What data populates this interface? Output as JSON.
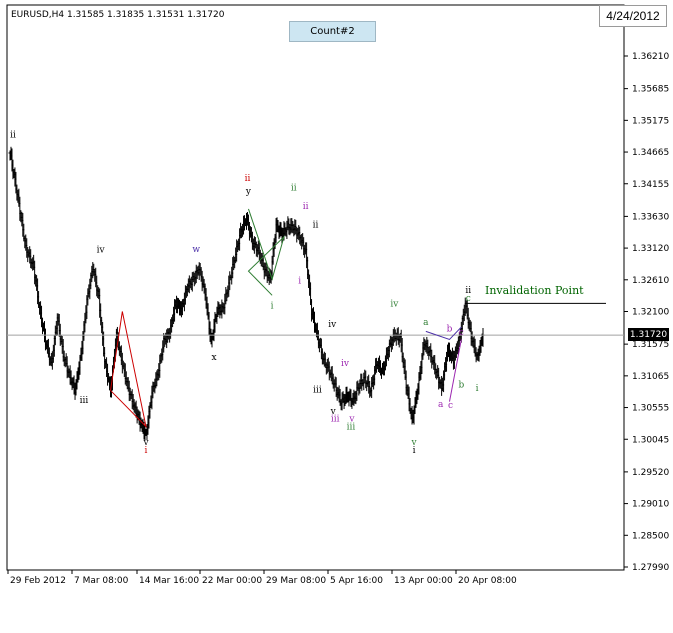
{
  "header": {
    "symbol_info": "EURUSD,H4  1.31585 1.31835 1.31531 1.31720",
    "count_label": "Count#2",
    "date_stamp": "4/24/2012"
  },
  "chart_data": {
    "type": "bar",
    "symbol": "EURUSD",
    "timeframe": "H4",
    "ohlc": {
      "open": 1.31585,
      "high": 1.31835,
      "low": 1.31531,
      "close": 1.3172
    },
    "current_price_label": "1.31720",
    "current_price": 1.3172,
    "y_ticks": [
      "1.36210",
      "1.35685",
      "1.35175",
      "1.34665",
      "1.34155",
      "1.33630",
      "1.33120",
      "1.32610",
      "1.32100",
      "1.31575",
      "1.31065",
      "1.30555",
      "1.30045",
      "1.29520",
      "1.29010",
      "1.28500",
      "1.27990"
    ],
    "ylim": [
      1.2799,
      1.3621
    ],
    "x_ticks": [
      "29 Feb 2012",
      "7 Mar 08:00",
      "14 Mar 16:00",
      "22 Mar 00:00",
      "29 Mar 08:00",
      "5 Apr 16:00",
      "13 Apr 00:00",
      "20 Apr 08:00"
    ],
    "grid": false,
    "close_path": [
      [
        0,
        1.3465
      ],
      [
        8,
        1.3392
      ],
      [
        16,
        1.3312
      ],
      [
        24,
        1.3281
      ],
      [
        30,
        1.3213
      ],
      [
        36,
        1.3162
      ],
      [
        42,
        1.3125
      ],
      [
        48,
        1.32
      ],
      [
        54,
        1.314
      ],
      [
        60,
        1.3108
      ],
      [
        66,
        1.3083
      ],
      [
        72,
        1.3141
      ],
      [
        78,
        1.3227
      ],
      [
        84,
        1.3282
      ],
      [
        90,
        1.3232
      ],
      [
        96,
        1.313
      ],
      [
        102,
        1.3083
      ],
      [
        108,
        1.3172
      ],
      [
        114,
        1.3126
      ],
      [
        120,
        1.3086
      ],
      [
        126,
        1.3057
      ],
      [
        132,
        1.3032
      ],
      [
        138,
        1.3011
      ],
      [
        144,
        1.308
      ],
      [
        150,
        1.311
      ],
      [
        156,
        1.3162
      ],
      [
        162,
        1.3176
      ],
      [
        168,
        1.3224
      ],
      [
        174,
        1.3213
      ],
      [
        180,
        1.325
      ],
      [
        186,
        1.3262
      ],
      [
        192,
        1.3279
      ],
      [
        198,
        1.3239
      ],
      [
        204,
        1.316
      ],
      [
        210,
        1.3212
      ],
      [
        216,
        1.3214
      ],
      [
        222,
        1.3254
      ],
      [
        228,
        1.3296
      ],
      [
        234,
        1.3338
      ],
      [
        240,
        1.336
      ],
      [
        246,
        1.3321
      ],
      [
        252,
        1.3308
      ],
      [
        258,
        1.3278
      ],
      [
        264,
        1.3262
      ],
      [
        270,
        1.3348
      ],
      [
        276,
        1.3335
      ],
      [
        282,
        1.3347
      ],
      [
        288,
        1.3345
      ],
      [
        294,
        1.333
      ],
      [
        300,
        1.3306
      ],
      [
        306,
        1.321
      ],
      [
        312,
        1.317
      ],
      [
        318,
        1.3132
      ],
      [
        324,
        1.3115
      ],
      [
        330,
        1.3089
      ],
      [
        336,
        1.3064
      ],
      [
        342,
        1.3075
      ],
      [
        348,
        1.3066
      ],
      [
        354,
        1.3091
      ],
      [
        360,
        1.3102
      ],
      [
        366,
        1.3082
      ],
      [
        372,
        1.3128
      ],
      [
        378,
        1.3113
      ],
      [
        384,
        1.315
      ],
      [
        390,
        1.3172
      ],
      [
        396,
        1.3166
      ],
      [
        402,
        1.3092
      ],
      [
        408,
        1.3035
      ],
      [
        414,
        1.3088
      ],
      [
        420,
        1.316
      ],
      [
        426,
        1.3143
      ],
      [
        432,
        1.3115
      ],
      [
        438,
        1.3086
      ],
      [
        444,
        1.3148
      ],
      [
        450,
        1.3132
      ],
      [
        456,
        1.3166
      ],
      [
        462,
        1.3223
      ],
      [
        468,
        1.317
      ],
      [
        474,
        1.3135
      ],
      [
        480,
        1.3172
      ]
    ],
    "annotations": [
      {
        "text": "ii",
        "bar": 3,
        "price": 1.349,
        "color": "#000000"
      },
      {
        "text": "iii",
        "bar": 75,
        "price": 1.3063,
        "color": "#000000"
      },
      {
        "text": "iv",
        "bar": 92,
        "price": 1.3305,
        "color": "#000000"
      },
      {
        "text": "v",
        "bar": 138,
        "price": 1.2995,
        "color": "#000000"
      },
      {
        "text": "i",
        "bar": 138,
        "price": 1.2982,
        "color": "#cc0000"
      },
      {
        "text": "w",
        "bar": 189,
        "price": 1.3306,
        "color": "#4b2fa8"
      },
      {
        "text": "x",
        "bar": 207,
        "price": 1.3132,
        "color": "#000000"
      },
      {
        "text": "ii",
        "bar": 241,
        "price": 1.342,
        "color": "#cc0000"
      },
      {
        "text": "y",
        "bar": 242,
        "price": 1.3399,
        "color": "#000000"
      },
      {
        "text": "ii",
        "bar": 288,
        "price": 1.3405,
        "color": "#2e7d32"
      },
      {
        "text": "ii",
        "bar": 300,
        "price": 1.3375,
        "color": "#9c27b0"
      },
      {
        "text": "ii",
        "bar": 310,
        "price": 1.3345,
        "color": "#000000"
      },
      {
        "text": "i",
        "bar": 266,
        "price": 1.3215,
        "color": "#2e7d32"
      },
      {
        "text": "i",
        "bar": 294,
        "price": 1.3255,
        "color": "#9c27b0"
      },
      {
        "text": "iv",
        "bar": 327,
        "price": 1.3185,
        "color": "#000000"
      },
      {
        "text": "iii",
        "bar": 312,
        "price": 1.308,
        "color": "#000000"
      },
      {
        "text": "iv",
        "bar": 340,
        "price": 1.3122,
        "color": "#9c27b0"
      },
      {
        "text": "v",
        "bar": 328,
        "price": 1.3045,
        "color": "#000000"
      },
      {
        "text": "iii",
        "bar": 330,
        "price": 1.3033,
        "color": "#9c27b0"
      },
      {
        "text": "v",
        "bar": 347,
        "price": 1.3033,
        "color": "#9c27b0"
      },
      {
        "text": "iii",
        "bar": 346,
        "price": 1.302,
        "color": "#2e7d32"
      },
      {
        "text": "iv",
        "bar": 390,
        "price": 1.3218,
        "color": "#2e7d32"
      },
      {
        "text": "v",
        "bar": 410,
        "price": 1.2995,
        "color": "#2e7d32"
      },
      {
        "text": "i",
        "bar": 410,
        "price": 1.2982,
        "color": "#000000"
      },
      {
        "text": "a",
        "bar": 422,
        "price": 1.3188,
        "color": "#2e7d32"
      },
      {
        "text": "a",
        "bar": 437,
        "price": 1.3056,
        "color": "#9c27b0"
      },
      {
        "text": "b",
        "bar": 446,
        "price": 1.3178,
        "color": "#9c27b0"
      },
      {
        "text": "c",
        "bar": 447,
        "price": 1.3055,
        "color": "#9c27b0"
      },
      {
        "text": "c",
        "bar": 458,
        "price": 1.3172,
        "color": "#9c27b0"
      },
      {
        "text": "b",
        "bar": 458,
        "price": 1.3088,
        "color": "#2e7d32"
      },
      {
        "text": "ii",
        "bar": 465,
        "price": 1.324,
        "color": "#000000"
      },
      {
        "text": "c",
        "bar": 465,
        "price": 1.3227,
        "color": "#2e7d32"
      },
      {
        "text": "i",
        "bar": 474,
        "price": 1.3082,
        "color": "#2e7d32"
      }
    ],
    "invalidation": {
      "label": "Invalidation Point",
      "price": 1.3223,
      "color": "#006400"
    }
  }
}
